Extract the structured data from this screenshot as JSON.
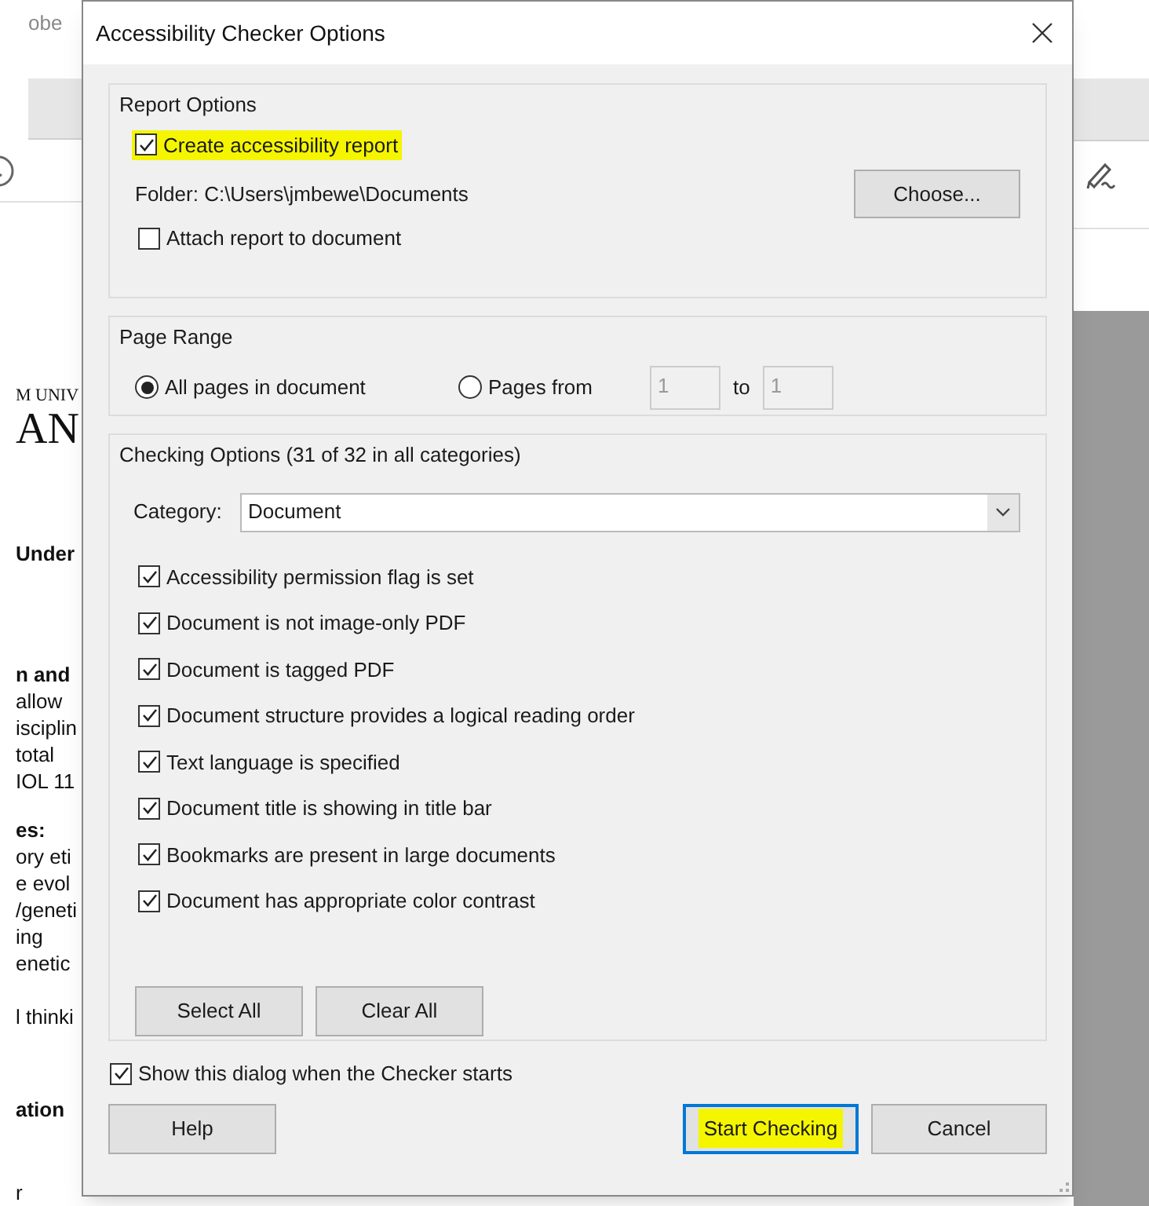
{
  "background_app": {
    "title_fragment": "obe",
    "document_fragments": [
      {
        "text": "M UNIV",
        "kind": "caps"
      },
      {
        "text": "AN",
        "kind": "heading"
      },
      {
        "text": "Under",
        "kind": "bold"
      },
      {
        "text": "n and",
        "kind": "bold"
      },
      {
        "text": "allow",
        "kind": "plain"
      },
      {
        "text": "isciplin",
        "kind": "plain"
      },
      {
        "text": "total",
        "kind": "plain"
      },
      {
        "text": "IOL 11",
        "kind": "plain"
      },
      {
        "text": "es:",
        "kind": "bold"
      },
      {
        "text": "ory eti",
        "kind": "plain"
      },
      {
        "text": "e evol",
        "kind": "plain"
      },
      {
        "text": "/geneti",
        "kind": "plain"
      },
      {
        "text": "ing",
        "kind": "plain"
      },
      {
        "text": "enetic",
        "kind": "plain"
      },
      {
        "text": "l thinki",
        "kind": "plain"
      },
      {
        "text": "ation",
        "kind": "bold"
      },
      {
        "text": "r",
        "kind": "plain"
      }
    ]
  },
  "dialog": {
    "title": "Accessibility Checker Options",
    "report_options": {
      "title": "Report Options",
      "create_report": {
        "label": "Create accessibility report",
        "checked": true,
        "highlighted": true
      },
      "folder": "Folder: C:\\Users\\jmbewe\\Documents",
      "choose_button": "Choose...",
      "attach_report": {
        "label": "Attach report to document",
        "checked": false
      }
    },
    "page_range": {
      "title": "Page Range",
      "options": [
        {
          "label": "All pages in document",
          "selected": true
        },
        {
          "label": "Pages from",
          "selected": false
        }
      ],
      "from": "1",
      "to_label": "to",
      "to": "1"
    },
    "checking_options": {
      "title": "Checking Options (31 of 32 in all categories)",
      "category_label": "Category:",
      "category": "Document",
      "rules": [
        {
          "label": "Accessibility permission flag is set",
          "checked": true
        },
        {
          "label": "Document is not image-only PDF",
          "checked": true
        },
        {
          "label": "Document is tagged PDF",
          "checked": true
        },
        {
          "label": "Document structure provides a logical reading order",
          "checked": true
        },
        {
          "label": "Text language is specified",
          "checked": true
        },
        {
          "label": "Document title is showing in title bar",
          "checked": true
        },
        {
          "label": "Bookmarks are present in large documents",
          "checked": true
        },
        {
          "label": "Document has appropriate color contrast",
          "checked": true
        }
      ],
      "select_all": "Select All",
      "clear_all": "Clear All"
    },
    "show_dialog": {
      "label": "Show this dialog when the Checker starts",
      "checked": true
    },
    "buttons": [
      {
        "label": "Help",
        "kind": "plain",
        "highlighted": false
      },
      {
        "label": "Start Checking",
        "kind": "default",
        "highlighted": true
      },
      {
        "label": "Cancel",
        "kind": "plain",
        "highlighted": false
      }
    ]
  }
}
